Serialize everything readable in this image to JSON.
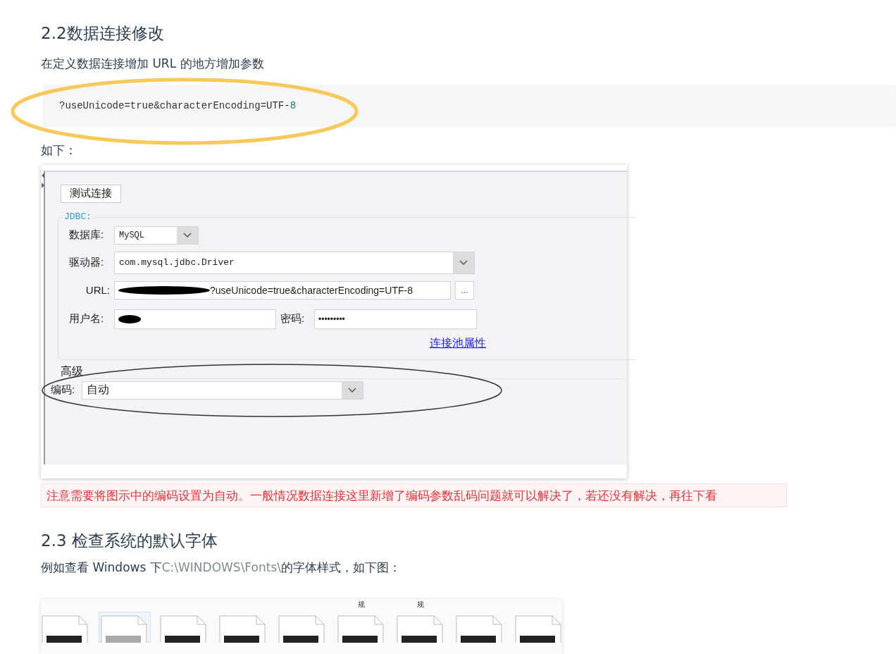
{
  "heading_1": "2.2数据连接修改",
  "paragraph_1": "在定义数据连接增加 URL 的地方增加参数",
  "code": [
    {
      "kind": "text",
      "text": "?useUnicode=true&characterEncoding=UTF-"
    },
    {
      "kind": "number",
      "text": "8"
    }
  ],
  "paragraph_2": "如下：",
  "dialog": {
    "test_button": "测试连接",
    "group_title": "JDBC:",
    "database": {
      "label": "数据库:",
      "value": "MySQL"
    },
    "driver": {
      "label": "驱动器:",
      "value": "com.mysql.jdbc.Driver"
    },
    "url": {
      "label": "URL:",
      "value": "?useUnicode=true&characterEncoding=UTF-8",
      "browse_button": "..."
    },
    "username": {
      "label": "用户名:"
    },
    "password": {
      "label": "密码:",
      "value": "•••••••••"
    },
    "pool_link": "连接池属性",
    "advanced_title": "高级",
    "encoding": {
      "label": "编码:",
      "value": "自动"
    }
  },
  "note": "注意需要将图示中的编码设置为自动。一般情况数据连接这里新增了编码参数乱码问题就可以解决了，若还没有解决，再往下看",
  "heading_2": "2.3 检查系统的默认字体",
  "paragraph_3": [
    {
      "kind": "text",
      "text": "例如查看 Windows 下"
    },
    {
      "kind": "path",
      "text": "C:\\WINDOWS\\Fonts\\"
    },
    {
      "kind": "text",
      "text": "的字体样式，如下图："
    }
  ],
  "font_files": [
    {
      "selected": false
    },
    {
      "selected": true
    },
    {
      "selected": false
    },
    {
      "selected": false
    },
    {
      "selected": false
    },
    {
      "selected": false,
      "caption": "规"
    },
    {
      "selected": false,
      "caption": "规"
    },
    {
      "selected": false
    },
    {
      "selected": false
    }
  ]
}
